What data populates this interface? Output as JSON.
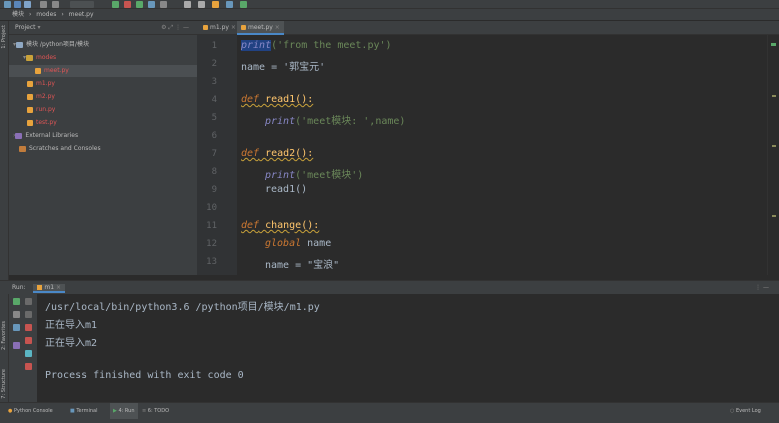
{
  "breadcrumb": [
    "模块",
    "modes",
    "meet.py"
  ],
  "project": {
    "header": "Project",
    "tree": [
      {
        "label": "模块  /python项目/模块",
        "type": "folder"
      },
      {
        "label": "modes",
        "type": "folder"
      },
      {
        "label": "meet.py",
        "type": "file"
      },
      {
        "label": "m1.py",
        "type": "file"
      },
      {
        "label": "m2.py",
        "type": "file"
      },
      {
        "label": "run.py",
        "type": "file"
      },
      {
        "label": "test.py",
        "type": "file"
      },
      {
        "label": "External Libraries",
        "type": "lib"
      },
      {
        "label": "Scratches and Consoles",
        "type": "lib"
      }
    ]
  },
  "tabs": [
    "m1.py",
    "meet.py"
  ],
  "editor": {
    "line_numbers": [
      "1",
      "2",
      "3",
      "4",
      "5",
      "6",
      "7",
      "8",
      "9",
      "10",
      "11",
      "12",
      "13"
    ],
    "lines": {
      "l1_print": "print",
      "l1_args": "('from the meet.py')",
      "l2": "name = '郭宝元'",
      "l4_def": "def",
      "l4_name": " read1():",
      "l5_print": "print",
      "l5_args": "('meet模块: ',name)",
      "l7_def": "def",
      "l7_name": " read2():",
      "l8_print": "print",
      "l8_args": "('meet模块')",
      "l9": "read1()",
      "l11_def": "def",
      "l11_name": " change():",
      "l12_kw": "global",
      "l12_rest": " name",
      "l13": "name = \"宝浪\""
    }
  },
  "run": {
    "label": "Run:",
    "tab": "m1",
    "output": [
      "/usr/local/bin/python3.6 /python项目/模块/m1.py",
      "正在导入m1",
      "正在导入m2",
      "",
      "Process finished with exit code 0"
    ]
  },
  "left_stripe": {
    "project": "1: Project",
    "favorites": "2: Favorites",
    "structure": "7: Structure"
  },
  "status": {
    "python_console": "Python Console",
    "terminal": "Terminal",
    "run": "4: Run",
    "todo": "6: TODO",
    "event_log": "Event Log"
  }
}
